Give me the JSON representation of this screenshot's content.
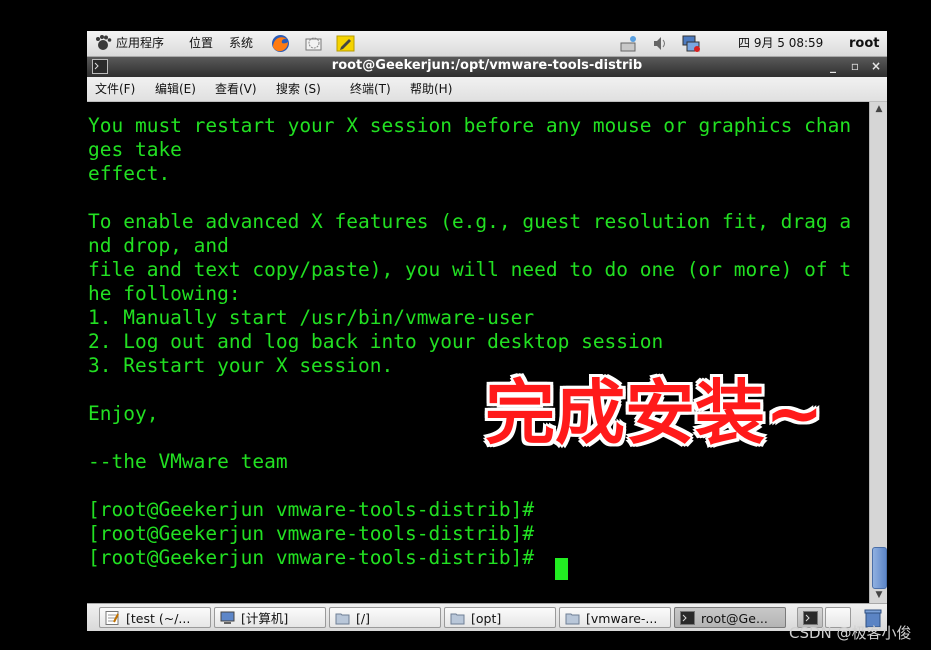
{
  "top_panel": {
    "applications": "应用程序",
    "places": "位置",
    "system": "系统",
    "clock": "四 9月  5 08:59",
    "user": "root"
  },
  "window": {
    "title": "root@Geekerjun:/opt/vmware-tools-distrib",
    "minimize": "_",
    "maximize": "▫",
    "close": "×",
    "menu": [
      "文件(F)",
      "编辑(E)",
      "查看(V)",
      "搜索 (S)",
      "终端(T)",
      "帮助(H)"
    ]
  },
  "terminal": {
    "lines": [
      "You must restart your X session before any mouse or graphics chan",
      "ges take",
      "effect.",
      "",
      "To enable advanced X features (e.g., guest resolution fit, drag a",
      "nd drop, and",
      "file and text copy/paste), you will need to do one (or more) of t",
      "he following:",
      "1. Manually start /usr/bin/vmware-user",
      "2. Log out and log back into your desktop session",
      "3. Restart your X session.",
      "",
      "Enjoy,",
      "",
      "--the VMware team",
      "",
      "[root@Geekerjun vmware-tools-distrib]#",
      "[root@Geekerjun vmware-tools-distrib]#",
      "[root@Geekerjun vmware-tools-distrib]# "
    ]
  },
  "overlay_text": "完成安装~",
  "taskbar": {
    "tasks": [
      {
        "label": "[test (~/..."
      },
      {
        "label": "[计算机]"
      },
      {
        "label": "[/]"
      },
      {
        "label": "[opt]"
      },
      {
        "label": "[vmware-..."
      },
      {
        "label": "root@Ge..."
      }
    ]
  },
  "watermark": "CSDN @极客小俊",
  "colors": {
    "terminal_text": "#22e022",
    "overlay_red": "#ff1a1a"
  }
}
